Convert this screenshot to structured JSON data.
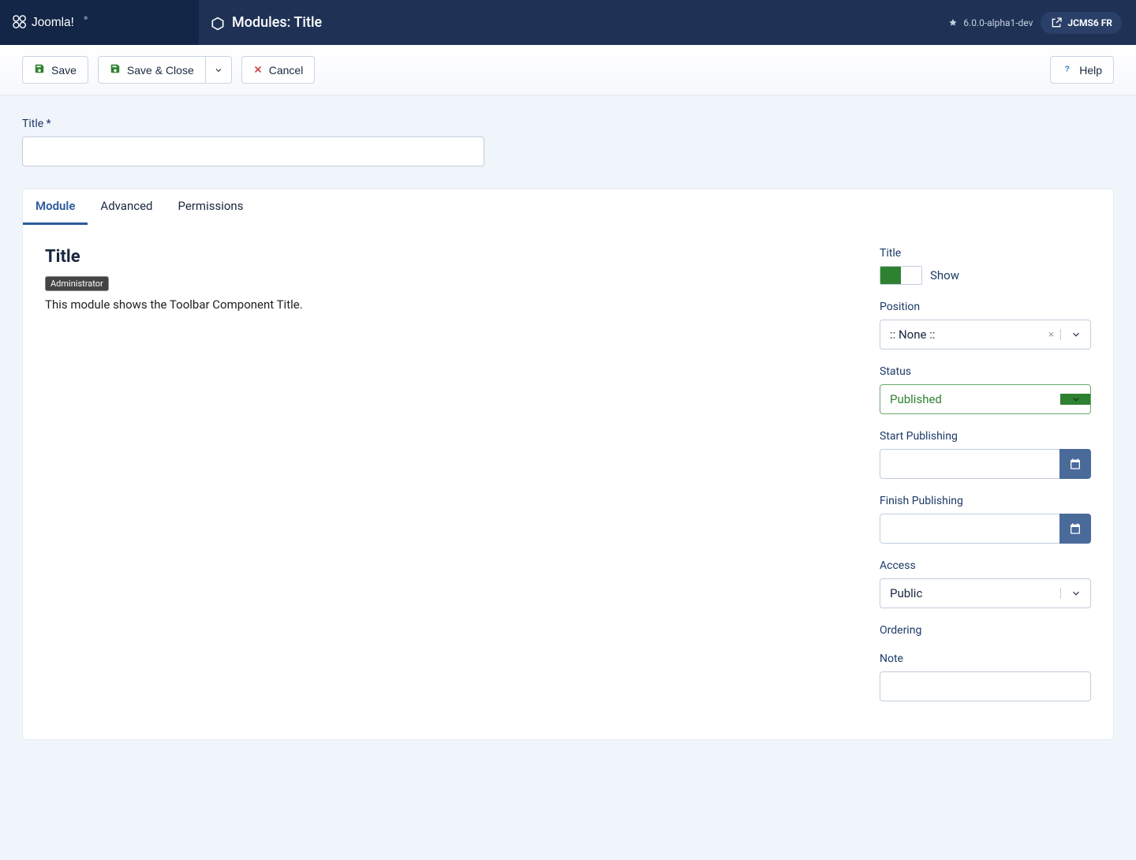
{
  "header": {
    "brand": "Joomla!",
    "page_title": "Modules: Title",
    "version": "6.0.0-alpha1-dev",
    "user": "JCMS6 FR"
  },
  "toolbar": {
    "save": "Save",
    "save_close": "Save & Close",
    "cancel": "Cancel",
    "help": "Help"
  },
  "form": {
    "title_label": "Title *",
    "title_value": ""
  },
  "tabs": [
    "Module",
    "Advanced",
    "Permissions"
  ],
  "active_tab": 0,
  "module": {
    "heading": "Title",
    "badge": "Administrator",
    "description": "This module shows the Toolbar Component Title."
  },
  "side": {
    "title_label": "Title",
    "title_toggle_state": "Show",
    "position_label": "Position",
    "position_value": ":: None ::",
    "status_label": "Status",
    "status_value": "Published",
    "start_pub_label": "Start Publishing",
    "start_pub_value": "",
    "finish_pub_label": "Finish Publishing",
    "finish_pub_value": "",
    "access_label": "Access",
    "access_value": "Public",
    "ordering_label": "Ordering",
    "note_label": "Note",
    "note_value": ""
  }
}
